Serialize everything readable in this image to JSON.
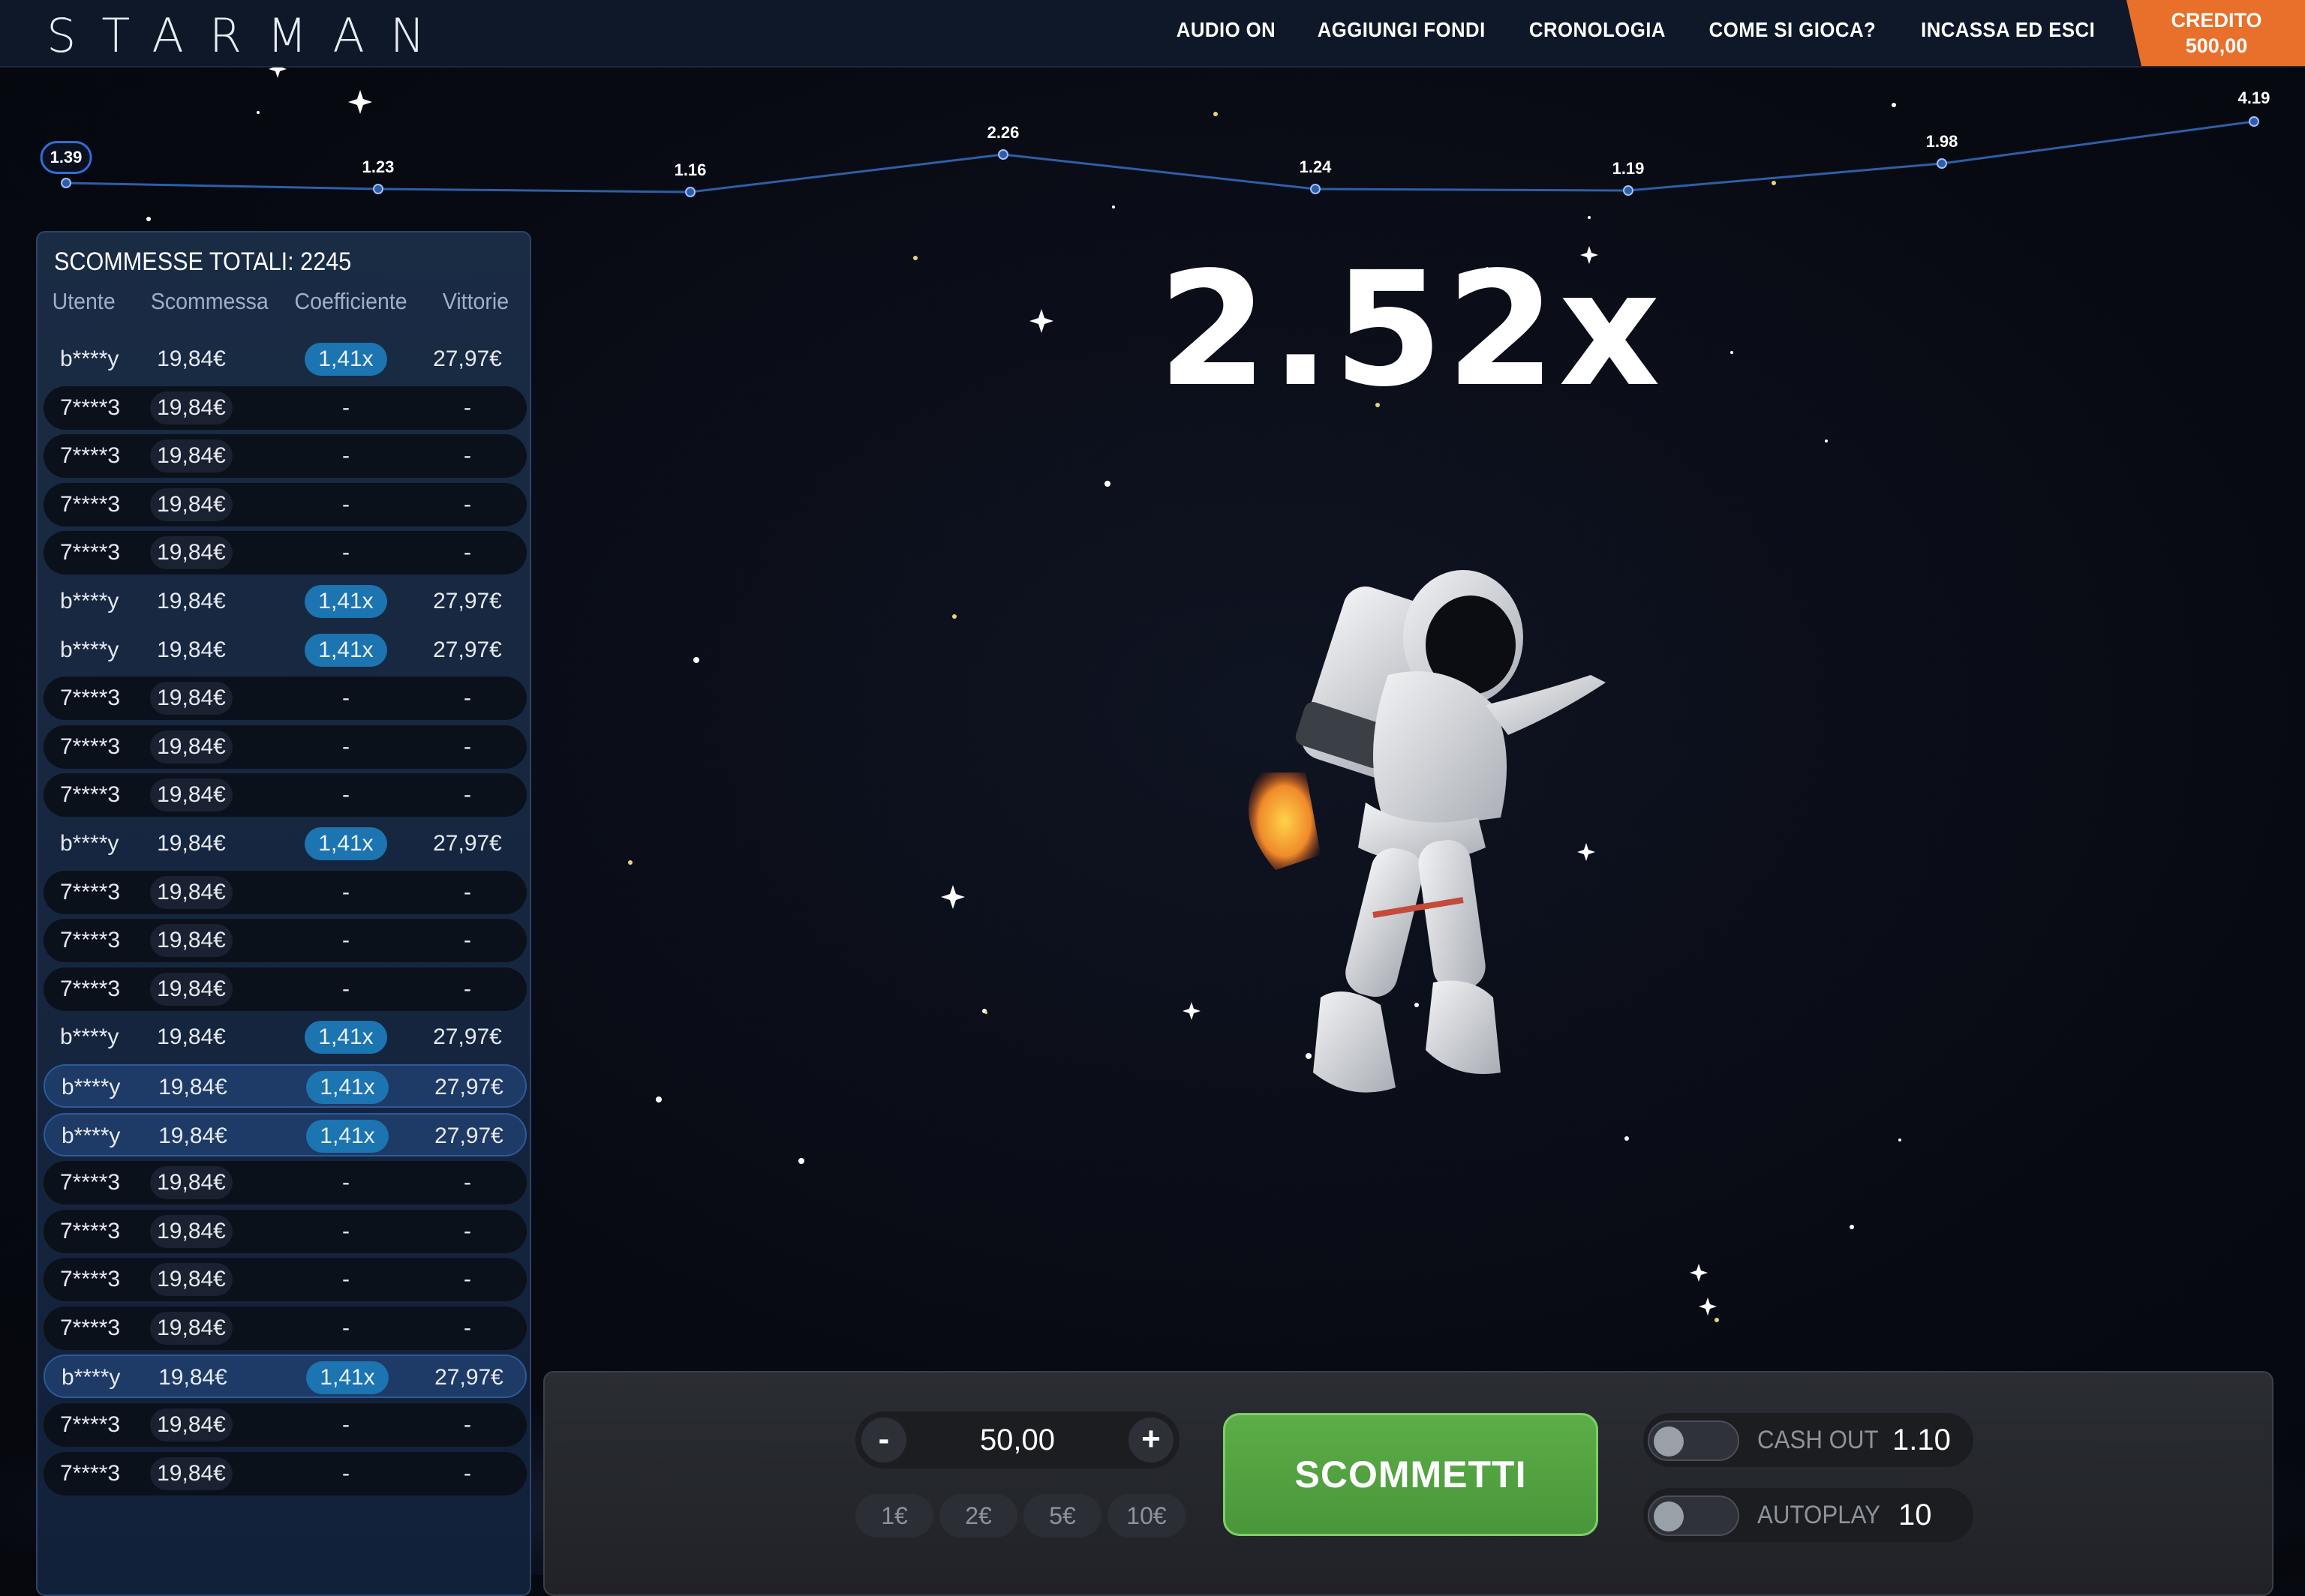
{
  "header": {
    "logo": "STARMAN",
    "nav": [
      "AUDIO ON",
      "AGGIUNGI FONDI",
      "CRONOLOGIA",
      "COME SI GIOCA?",
      "INCASSA ED ESCI"
    ],
    "credit_label": "CREDITO",
    "credit_value": "500,00"
  },
  "history": [
    "1.39",
    "1.23",
    "1.16",
    "2.26",
    "1.24",
    "1.19",
    "1.98",
    "4.19"
  ],
  "multiplier": "2.52x",
  "bets_panel": {
    "title": "SCOMMESSE TOTALI: 2245",
    "columns": [
      "Utente",
      "Scommessa",
      "Coefficiente",
      "Vittorie"
    ],
    "rows": [
      {
        "user": "b****y",
        "bet": "19,84€",
        "coef": "1,41x",
        "win": "27,97€"
      },
      {
        "user": "7****3",
        "bet": "19,84€",
        "coef": "-",
        "win": "-"
      },
      {
        "user": "7****3",
        "bet": "19,84€",
        "coef": "-",
        "win": "-"
      },
      {
        "user": "7****3",
        "bet": "19,84€",
        "coef": "-",
        "win": "-"
      },
      {
        "user": "7****3",
        "bet": "19,84€",
        "coef": "-",
        "win": "-"
      },
      {
        "user": "b****y",
        "bet": "19,84€",
        "coef": "1,41x",
        "win": "27,97€"
      },
      {
        "user": "b****y",
        "bet": "19,84€",
        "coef": "1,41x",
        "win": "27,97€"
      },
      {
        "user": "7****3",
        "bet": "19,84€",
        "coef": "-",
        "win": "-"
      },
      {
        "user": "7****3",
        "bet": "19,84€",
        "coef": "-",
        "win": "-"
      },
      {
        "user": "7****3",
        "bet": "19,84€",
        "coef": "-",
        "win": "-"
      },
      {
        "user": "b****y",
        "bet": "19,84€",
        "coef": "1,41x",
        "win": "27,97€"
      },
      {
        "user": "7****3",
        "bet": "19,84€",
        "coef": "-",
        "win": "-"
      },
      {
        "user": "7****3",
        "bet": "19,84€",
        "coef": "-",
        "win": "-"
      },
      {
        "user": "7****3",
        "bet": "19,84€",
        "coef": "-",
        "win": "-"
      },
      {
        "user": "b****y",
        "bet": "19,84€",
        "coef": "1,41x",
        "win": "27,97€"
      },
      {
        "user": "b****y",
        "bet": "19,84€",
        "coef": "1,41x",
        "win": "27,97€",
        "highlight": true
      },
      {
        "user": "b****y",
        "bet": "19,84€",
        "coef": "1,41x",
        "win": "27,97€",
        "highlight": true
      },
      {
        "user": "7****3",
        "bet": "19,84€",
        "coef": "-",
        "win": "-"
      },
      {
        "user": "7****3",
        "bet": "19,84€",
        "coef": "-",
        "win": "-"
      },
      {
        "user": "7****3",
        "bet": "19,84€",
        "coef": "-",
        "win": "-"
      },
      {
        "user": "7****3",
        "bet": "19,84€",
        "coef": "-",
        "win": "-"
      },
      {
        "user": "b****y",
        "bet": "19,84€",
        "coef": "1,41x",
        "win": "27,97€",
        "highlight": true
      },
      {
        "user": "7****3",
        "bet": "19,84€",
        "coef": "-",
        "win": "-"
      },
      {
        "user": "7****3",
        "bet": "19,84€",
        "coef": "-",
        "win": "-"
      }
    ]
  },
  "controls": {
    "minus": "-",
    "plus": "+",
    "amount": "50,00",
    "quick": [
      "1€",
      "2€",
      "5€",
      "10€"
    ],
    "bet_button": "SCOMMETTI",
    "cashout_label": "CASH OUT",
    "cashout_value": "1.10",
    "autoplay_label": "AUTOPLAY",
    "autoplay_value": "10"
  },
  "colors": {
    "accent_orange": "#e8702a",
    "bet_green": "#4e9e3e",
    "coef_blue": "#1c74b0",
    "history_line": "#2d5fa8"
  }
}
